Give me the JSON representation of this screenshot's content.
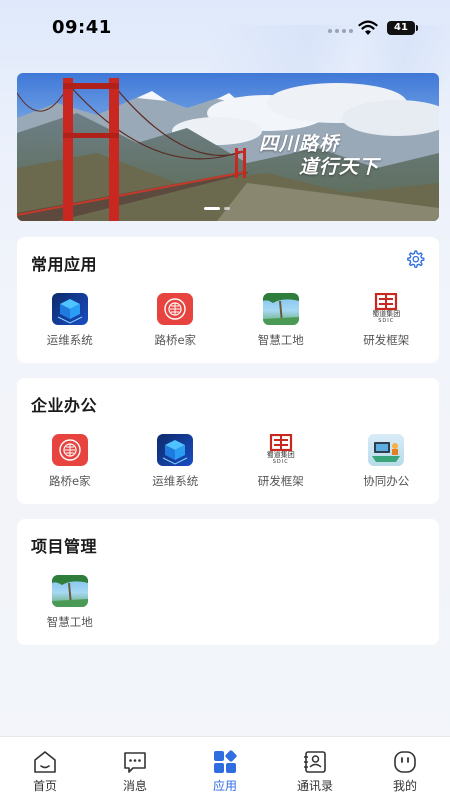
{
  "status_bar": {
    "time": "09:41",
    "battery": "41"
  },
  "banner": {
    "line1": "四川路桥",
    "line2": "道行天下"
  },
  "sections": [
    {
      "title": "常用应用",
      "apps": [
        {
          "label": "运维系统",
          "icon": "ops-system-icon"
        },
        {
          "label": "路桥e家",
          "icon": "road-bridge-home-icon"
        },
        {
          "label": "智慧工地",
          "icon": "smart-site-icon"
        },
        {
          "label": "研发框架",
          "icon": "sdic-logo-icon"
        }
      ]
    },
    {
      "title": "企业办公",
      "apps": [
        {
          "label": "路桥e家",
          "icon": "road-bridge-home-icon"
        },
        {
          "label": "运维系统",
          "icon": "ops-system-icon"
        },
        {
          "label": "研发框架",
          "icon": "sdic-logo-icon"
        },
        {
          "label": "协同办公",
          "icon": "collab-office-icon"
        }
      ]
    },
    {
      "title": "项目管理",
      "apps": [
        {
          "label": "智慧工地",
          "icon": "smart-site-icon"
        }
      ]
    }
  ],
  "sdic_logo": {
    "text": "蜀道集团",
    "sub": "SDIC"
  },
  "tabbar": [
    {
      "label": "首页",
      "icon": "home-icon"
    },
    {
      "label": "消息",
      "icon": "message-icon"
    },
    {
      "label": "应用",
      "icon": "apps-icon",
      "active": true
    },
    {
      "label": "通讯录",
      "icon": "contacts-icon"
    },
    {
      "label": "我的",
      "icon": "profile-icon"
    }
  ],
  "colors": {
    "accent": "#2f6de1",
    "road_red": "#e8443f"
  }
}
